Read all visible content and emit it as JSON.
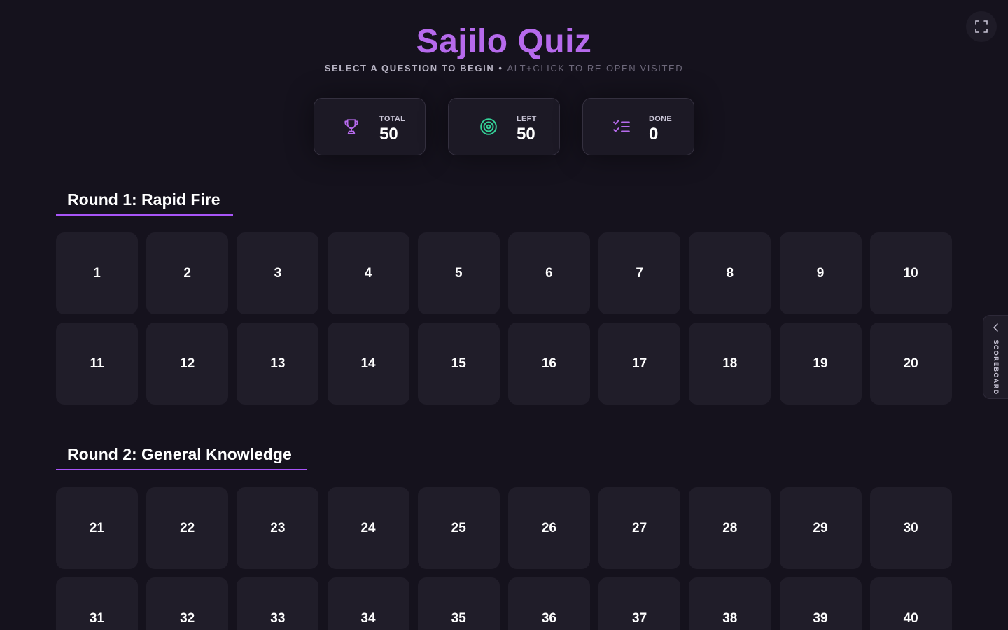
{
  "header": {
    "title": "Sajilo Quiz",
    "subtitle_main": "SELECT A QUESTION TO BEGIN",
    "subtitle_separator": "•",
    "subtitle_hint": "ALT+CLICK TO RE-OPEN VISITED"
  },
  "controls": {
    "fullscreen_icon": "fullscreen-icon"
  },
  "stats": {
    "total": {
      "label": "TOTAL",
      "value": "50",
      "icon": "trophy-icon",
      "color": "#b66aec"
    },
    "left": {
      "label": "LEFT",
      "value": "50",
      "icon": "target-icon",
      "color": "#34d399"
    },
    "done": {
      "label": "DONE",
      "value": "0",
      "icon": "checklist-icon",
      "color": "#b66aec"
    }
  },
  "rounds": [
    {
      "title": "Round 1: Rapid Fire",
      "questions": [
        "1",
        "2",
        "3",
        "4",
        "5",
        "6",
        "7",
        "8",
        "9",
        "10",
        "11",
        "12",
        "13",
        "14",
        "15",
        "16",
        "17",
        "18",
        "19",
        "20"
      ]
    },
    {
      "title": "Round 2: General Knowledge",
      "questions": [
        "21",
        "22",
        "23",
        "24",
        "25",
        "26",
        "27",
        "28",
        "29",
        "30",
        "31",
        "32",
        "33",
        "34",
        "35",
        "36",
        "37",
        "38",
        "39",
        "40"
      ]
    }
  ],
  "scoreboard": {
    "label": "SCOREBOARD",
    "icon": "chevron-left-icon"
  },
  "colors": {
    "background": "#15121d",
    "accent": "#b66aec",
    "tile": "#201d29",
    "success": "#34d399"
  }
}
